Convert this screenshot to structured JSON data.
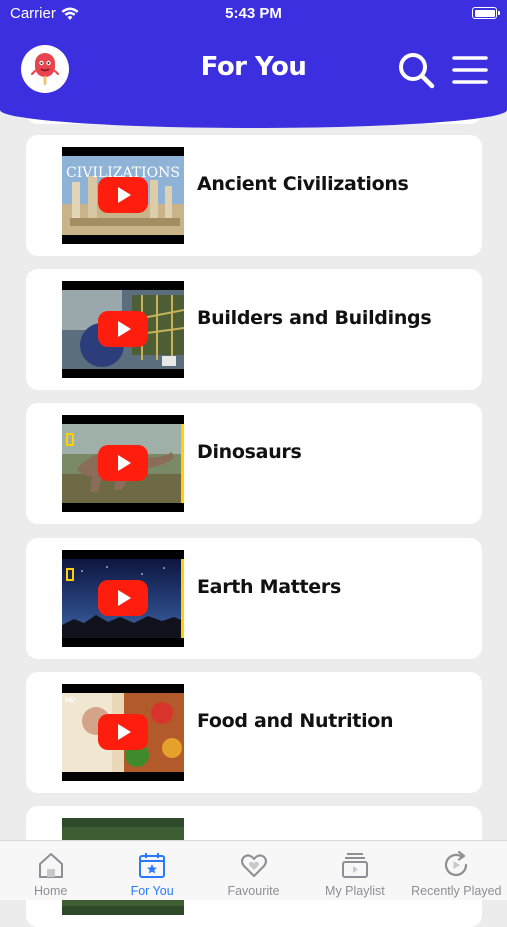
{
  "status_bar": {
    "carrier": "Carrier",
    "time": "5:43 PM"
  },
  "header": {
    "title": "For You",
    "logo_icon": "popsicle-mascot-icon",
    "search_icon": "search-icon",
    "menu_icon": "menu-icon",
    "background_color": "#3b2fe0"
  },
  "videos": [
    {
      "title": "Ancient Civilizations",
      "thumbnail_text": "CIVILIZATIONS"
    },
    {
      "title": "Builders and Buildings"
    },
    {
      "title": "Dinosaurs"
    },
    {
      "title": "Earth Matters"
    },
    {
      "title": "Food and Nutrition",
      "thumbnail_text": "HD"
    }
  ],
  "tabs": [
    {
      "label": "Home",
      "icon": "home-icon",
      "active": false
    },
    {
      "label": "For You",
      "icon": "calendar-star-icon",
      "active": true
    },
    {
      "label": "Favourite",
      "icon": "heart-icon",
      "active": false
    },
    {
      "label": "My Playlist",
      "icon": "playlist-icon",
      "active": false
    },
    {
      "label": "Recently Played",
      "icon": "replay-icon",
      "active": false
    }
  ],
  "colors": {
    "accent": "#3b2fe0",
    "tab_active": "#2979ff",
    "tab_inactive": "#8e8e93",
    "play_button": "#ff1e0e"
  }
}
